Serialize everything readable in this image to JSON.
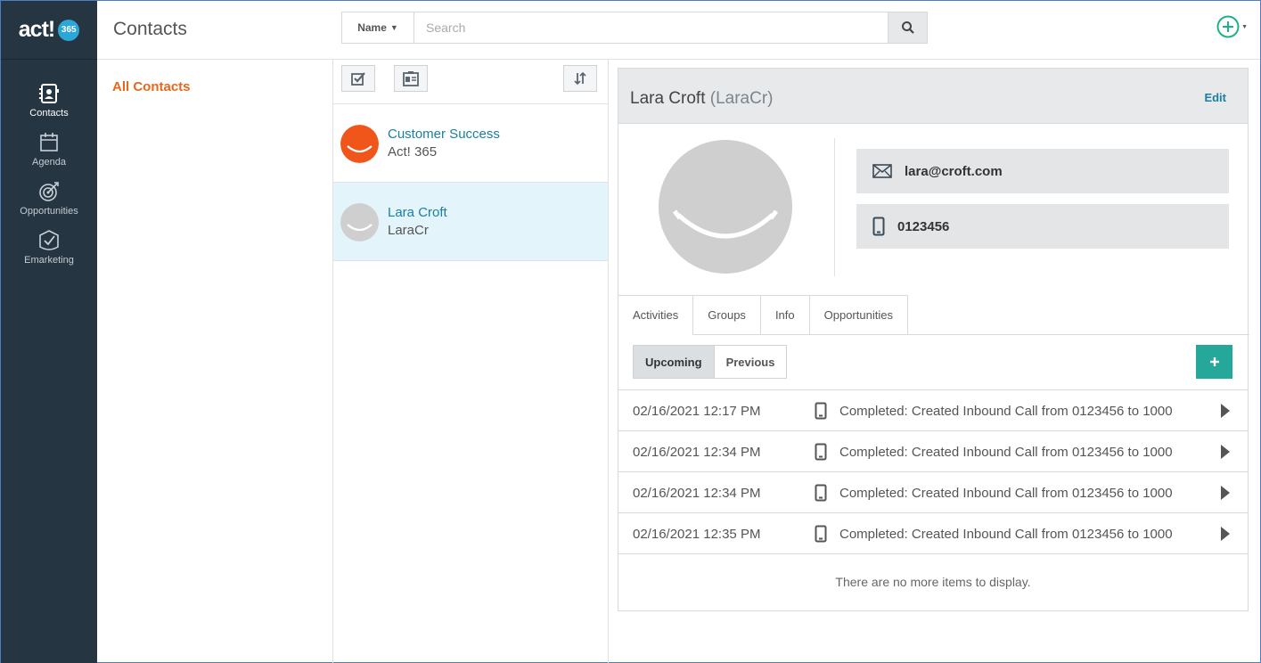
{
  "app": {
    "logo_text": "act!",
    "logo_badge": "365"
  },
  "nav": {
    "items": [
      {
        "label": "Contacts",
        "icon": "contacts-icon"
      },
      {
        "label": "Agenda",
        "icon": "calendar-icon"
      },
      {
        "label": "Opportunities",
        "icon": "target-icon"
      },
      {
        "label": "Emarketing",
        "icon": "emarketing-icon"
      }
    ]
  },
  "header": {
    "title": "Contacts",
    "search_field_selector": "Name",
    "search_placeholder": "Search"
  },
  "groups": {
    "all_label": "All Contacts"
  },
  "contacts": [
    {
      "name": "Customer Success",
      "sub": "Act! 365",
      "avatar_color": "#f0561a",
      "selected": false
    },
    {
      "name": "Lara Croft",
      "sub": "LaraCr",
      "avatar_color": "#cfcfcf",
      "selected": true
    }
  ],
  "detail": {
    "name": "Lara Croft",
    "alias": "(LaraCr)",
    "edit_label": "Edit",
    "email": "lara@croft.com",
    "phone": "0123456",
    "tabs": [
      "Activities",
      "Groups",
      "Info",
      "Opportunities"
    ],
    "subtabs": [
      "Upcoming",
      "Previous"
    ],
    "activities": [
      {
        "datetime": "02/16/2021 12:17 PM",
        "description": "Completed: Created Inbound Call from 0123456 to 1000"
      },
      {
        "datetime": "02/16/2021 12:34 PM",
        "description": "Completed: Created Inbound Call from 0123456 to 1000"
      },
      {
        "datetime": "02/16/2021 12:34 PM",
        "description": "Completed: Created Inbound Call from 0123456 to 1000"
      },
      {
        "datetime": "02/16/2021 12:35 PM",
        "description": "Completed: Created Inbound Call from 0123456 to 1000"
      }
    ],
    "empty_message": "There are no more items to display."
  },
  "colors": {
    "nav_bg": "#263542",
    "accent_orange": "#e4681d",
    "link_blue": "#1a7fa0",
    "teal_button": "#25a89a",
    "add_circle": "#1db385"
  }
}
